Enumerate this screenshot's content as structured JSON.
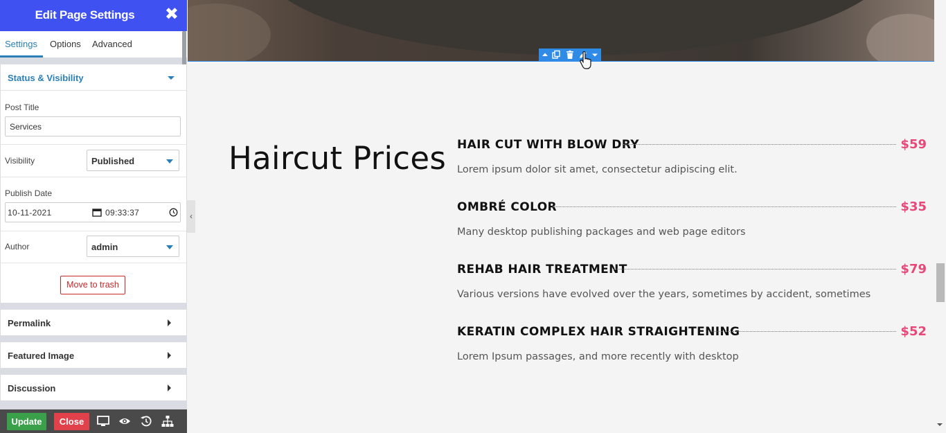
{
  "sidebar": {
    "title": "Edit Page Settings",
    "close_glyph": "✖",
    "tabs": [
      "Settings",
      "Options",
      "Advanced"
    ],
    "status_section": {
      "label": "Status & Visibility",
      "post_title_label": "Post Title",
      "post_title_value": "Services",
      "visibility_label": "Visibility",
      "visibility_value": "Published",
      "publish_date_label": "Publish Date",
      "publish_date": "10-11-2021",
      "publish_time": "09:33:37",
      "author_label": "Author",
      "author_value": "admin",
      "trash_label": "Move to trash"
    },
    "collapsed_sections": [
      "Permalink",
      "Featured Image",
      "Discussion"
    ],
    "footer": {
      "update_label": "Update",
      "close_label": "Close",
      "icons": [
        "desktop-icon",
        "eye-icon",
        "history-icon",
        "sitemap-icon"
      ]
    },
    "collapse_glyph": "‹"
  },
  "row_toolbar": {
    "icons": [
      "move-up-icon",
      "duplicate-icon",
      "trash-icon",
      "edit-pencil-icon",
      "dropdown-icon"
    ]
  },
  "content": {
    "heading": "Haircut Prices",
    "items": [
      {
        "name": "HAIR CUT WITH BLOW DRY",
        "price": "$59",
        "description": "Lorem ipsum dolor sit amet, consectetur adipiscing elit."
      },
      {
        "name": "OMBRÉ COLOR",
        "price": "$35",
        "description": "Many desktop publishing packages and web page editors"
      },
      {
        "name": "REHAB HAIR TREATMENT",
        "price": "$79",
        "description": "Various versions have evolved over the years, sometimes by accident, sometimes"
      },
      {
        "name": "KERATIN COMPLEX HAIR STRAIGHTENING",
        "price": "$52",
        "description": "Lorem Ipsum passages, and more recently with desktop"
      }
    ]
  },
  "colors": {
    "header_blue": "#3f51f0",
    "accent_blue": "#2a7fb8",
    "toolbar_blue": "#2f8be6",
    "price_pink": "#e8477a",
    "update_green": "#3aa14a",
    "close_red": "#e0414a"
  }
}
